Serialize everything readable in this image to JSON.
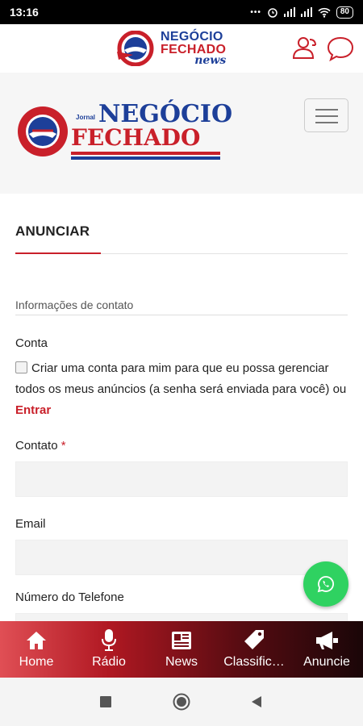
{
  "status_bar": {
    "time": "13:16",
    "battery": "80"
  },
  "app_header": {
    "logo_line1": "NEGÓCIO",
    "logo_line2": "FECHADO",
    "logo_line3": "news"
  },
  "site_header": {
    "title_small": "Jornal",
    "title_line1": "NEGÓCIO",
    "title_line2": "FECHADO",
    "seal_text": "JORNAL NEGÓCIO FECHADO"
  },
  "page": {
    "title": "ANUNCIAR",
    "section": "Informações de contato",
    "conta_label": "Conta",
    "checkbox_text": "Criar uma conta para mim para que eu possa gerenciar todos os meus anúncios (a senha será enviada para você) ou",
    "checkbox_link": "Entrar",
    "contato_label": "Contato",
    "required_mark": "*",
    "email_label": "Email",
    "phone_label": "Número do Telefone"
  },
  "bottom_nav": {
    "items": [
      {
        "label": "Home",
        "icon": "home-icon"
      },
      {
        "label": "Rádio",
        "icon": "microphone-icon"
      },
      {
        "label": "News",
        "icon": "newspaper-icon"
      },
      {
        "label": "Classific…",
        "icon": "tag-icon"
      },
      {
        "label": "Anuncie",
        "icon": "megaphone-icon"
      }
    ]
  },
  "colors": {
    "brand_red": "#c9202a",
    "brand_blue": "#1d3f99",
    "whatsapp_green": "#2fd261"
  }
}
